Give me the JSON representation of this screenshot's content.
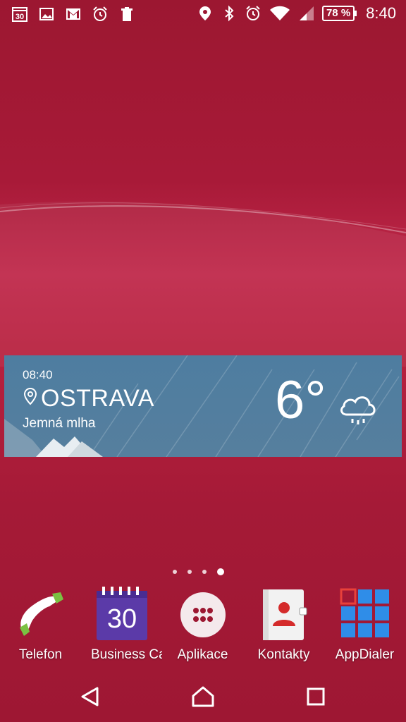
{
  "status_bar": {
    "left_icons": [
      "calendar-30-icon",
      "gallery-icon",
      "gmail-icon",
      "alarm-app-icon",
      "trash-icon"
    ],
    "calendar_day": "30",
    "right_icons": [
      "location-icon",
      "bluetooth-icon",
      "alarm-icon",
      "wifi-icon",
      "signal-icon"
    ],
    "battery": "78 %",
    "time": "8:40"
  },
  "weather": {
    "time": "08:40",
    "city": "OSTRAVA",
    "condition": "Jemná mlha",
    "temperature": "6°"
  },
  "page_dots": {
    "count": 4,
    "active": 3
  },
  "dock": {
    "apps": [
      {
        "label": "Telefon",
        "icon": "phone-icon"
      },
      {
        "label": "Business Cal",
        "icon": "business-calendar-icon",
        "icon_text": "30"
      },
      {
        "label": "Aplikace",
        "icon": "app-drawer-icon"
      },
      {
        "label": "Kontakty",
        "icon": "contacts-icon"
      },
      {
        "label": "AppDialer",
        "icon": "appdialer-icon"
      }
    ]
  },
  "nav": {
    "buttons": [
      "back-icon",
      "home-icon",
      "recents-icon"
    ]
  },
  "colors": {
    "wallpaper": "#a51a37",
    "weather_bg": "#52809f",
    "calendar_icon": "#5b3aa8",
    "appdialer_icon": "#2f8de8"
  }
}
